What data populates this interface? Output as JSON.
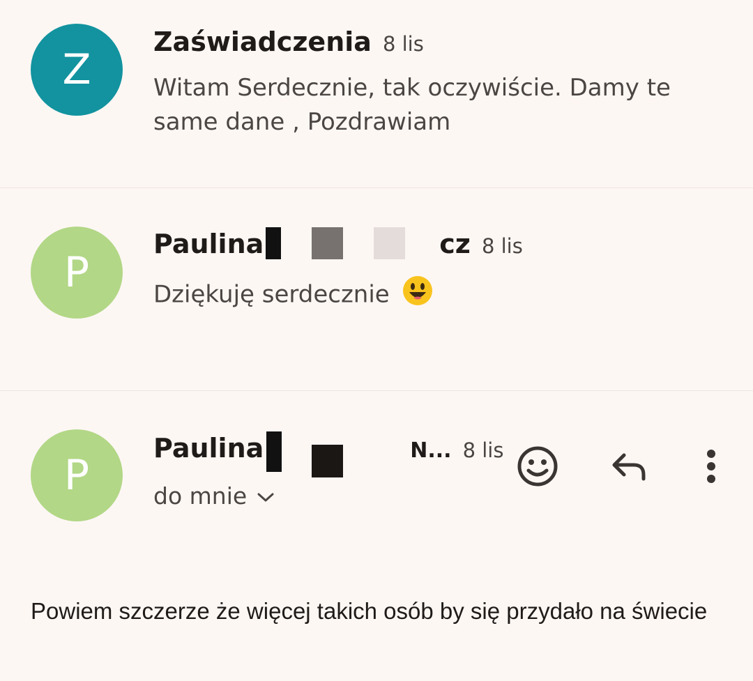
{
  "messages": [
    {
      "avatar_letter": "Z",
      "avatar_color": "#12939f",
      "sender": "Zaświadczenia",
      "date": "8 lis",
      "snippet": "Witam Serdecznie, tak oczywiście. Damy te same dane , Pozdrawiam"
    },
    {
      "avatar_letter": "P",
      "avatar_color": "#b2d786",
      "sender": "Paulina",
      "sender_tail": "cz",
      "date": "8 lis",
      "snippet": "Dziękuję serdecznie",
      "emoji": "grinning-face-icon"
    },
    {
      "avatar_letter": "P",
      "avatar_color": "#b2d786",
      "sender": "Paulina",
      "sender_tail": "N...",
      "date": "8 lis",
      "recipient": "do mnie",
      "body": "Powiem szczerze że więcej takich osób by się przydało na świecie",
      "actions": [
        "smiley-icon",
        "reply-icon",
        "more-vert-icon"
      ]
    }
  ],
  "colors": {
    "background": "#fdf7f4",
    "divider": "#ece4df",
    "text_primary": "#1f1b18",
    "text_secondary": "#4b4643"
  }
}
